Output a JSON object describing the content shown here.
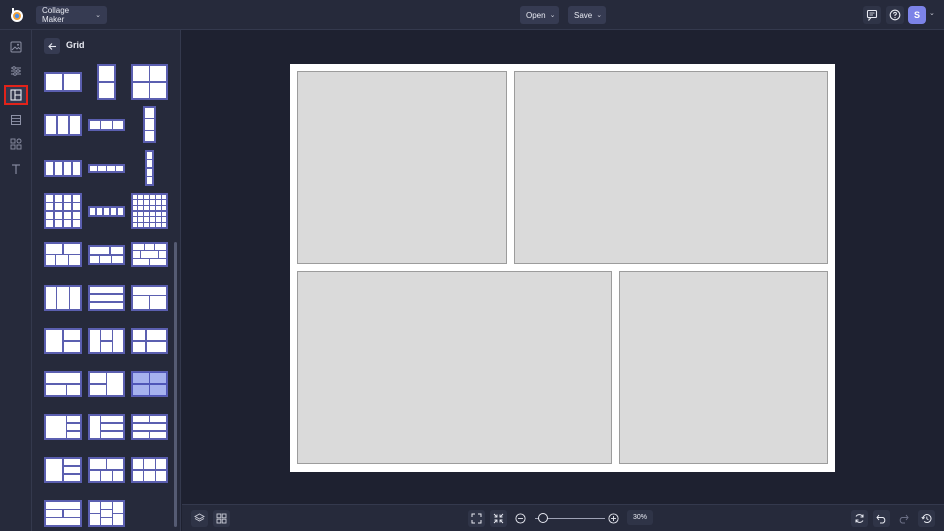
{
  "topbar": {
    "app_dropdown": "Collage Maker",
    "open_label": "Open",
    "save_label": "Save",
    "avatar_initial": "S"
  },
  "panel": {
    "title": "Grid"
  },
  "zoom": {
    "level_text": "30%",
    "level": 30
  },
  "colors": {
    "accent": "#7c83e8",
    "selected_highlight": "#e2231a",
    "background": "#1e2130",
    "panel": "#262a3b"
  },
  "icons": {
    "rail": [
      "image-icon",
      "adjustments-icon",
      "grid-layout-icon",
      "layers-list-icon",
      "elements-icon",
      "text-icon"
    ]
  }
}
